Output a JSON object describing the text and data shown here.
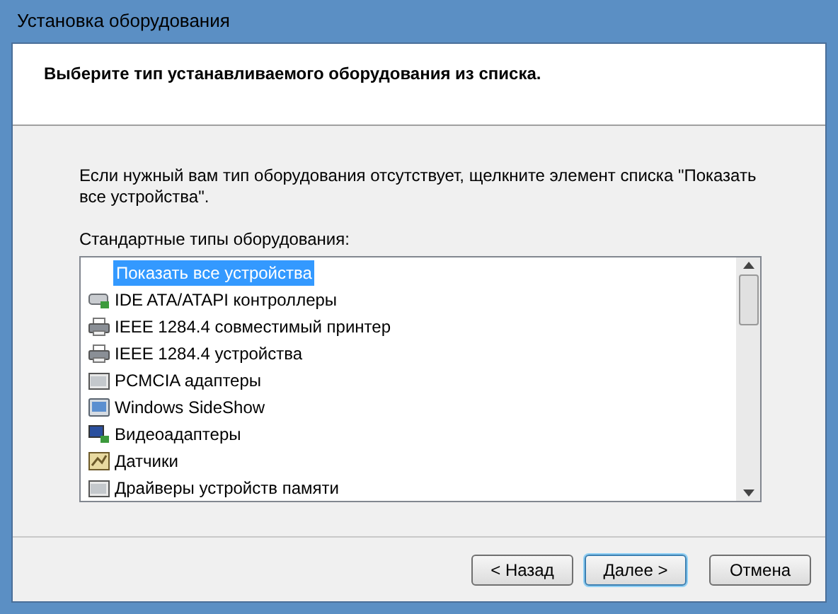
{
  "window": {
    "title": "Установка оборудования"
  },
  "header": {
    "instruction": "Выберите тип устанавливаемого оборудования из списка."
  },
  "body": {
    "hint": "Если нужный вам тип оборудования отсутствует, щелкните элемент списка \"Показать все устройства\".",
    "list_label": "Стандартные типы оборудования:"
  },
  "list": [
    {
      "label": "Показать все устройства",
      "kind": "none",
      "selected": true
    },
    {
      "label": "IDE ATA/ATAPI контроллеры",
      "kind": "drive",
      "selected": false
    },
    {
      "label": "IEEE 1284.4 совместимый принтер",
      "kind": "printer",
      "selected": false
    },
    {
      "label": "IEEE 1284.4 устройства",
      "kind": "printer",
      "selected": false
    },
    {
      "label": "PCMCIA адаптеры",
      "kind": "card",
      "selected": false
    },
    {
      "label": "Windows SideShow",
      "kind": "screen",
      "selected": false
    },
    {
      "label": "Видеоадаптеры",
      "kind": "monitor",
      "selected": false
    },
    {
      "label": "Датчики",
      "kind": "sensor",
      "selected": false
    },
    {
      "label": "Драйверы устройств памяти",
      "kind": "card",
      "selected": false
    }
  ],
  "buttons": [
    {
      "label": "< Назад",
      "default": false
    },
    {
      "label": "Далее >",
      "default": true
    },
    {
      "label": "Отмена",
      "default": false
    }
  ]
}
